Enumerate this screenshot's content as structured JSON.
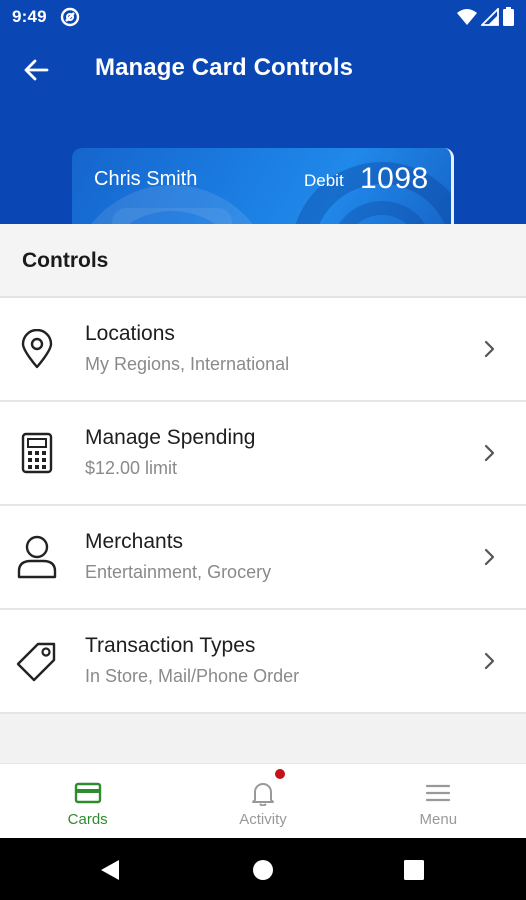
{
  "status": {
    "time": "9:49"
  },
  "appbar": {
    "title": "Manage Card Controls"
  },
  "card": {
    "holder": "Chris Smith",
    "type": "Debit",
    "last4": "1098"
  },
  "section": {
    "title": "Controls"
  },
  "controls": [
    {
      "title": "Locations",
      "subtitle": "My Regions, International",
      "icon": "location-pin-icon"
    },
    {
      "title": "Manage Spending",
      "subtitle": "$12.00 limit",
      "icon": "calculator-icon"
    },
    {
      "title": "Merchants",
      "subtitle": "Entertainment, Grocery",
      "icon": "person-icon"
    },
    {
      "title": "Transaction Types",
      "subtitle": "In Store, Mail/Phone Order",
      "icon": "tag-icon"
    }
  ],
  "bottom_nav": [
    {
      "label": "Cards",
      "icon": "card-icon",
      "active": true
    },
    {
      "label": "Activity",
      "icon": "bell-icon",
      "active": false
    },
    {
      "label": "Menu",
      "icon": "menu-icon",
      "active": false
    }
  ],
  "colors": {
    "header": "#0a47b5",
    "active_nav": "#2e8b2e",
    "notification_dot": "#c4121a"
  }
}
